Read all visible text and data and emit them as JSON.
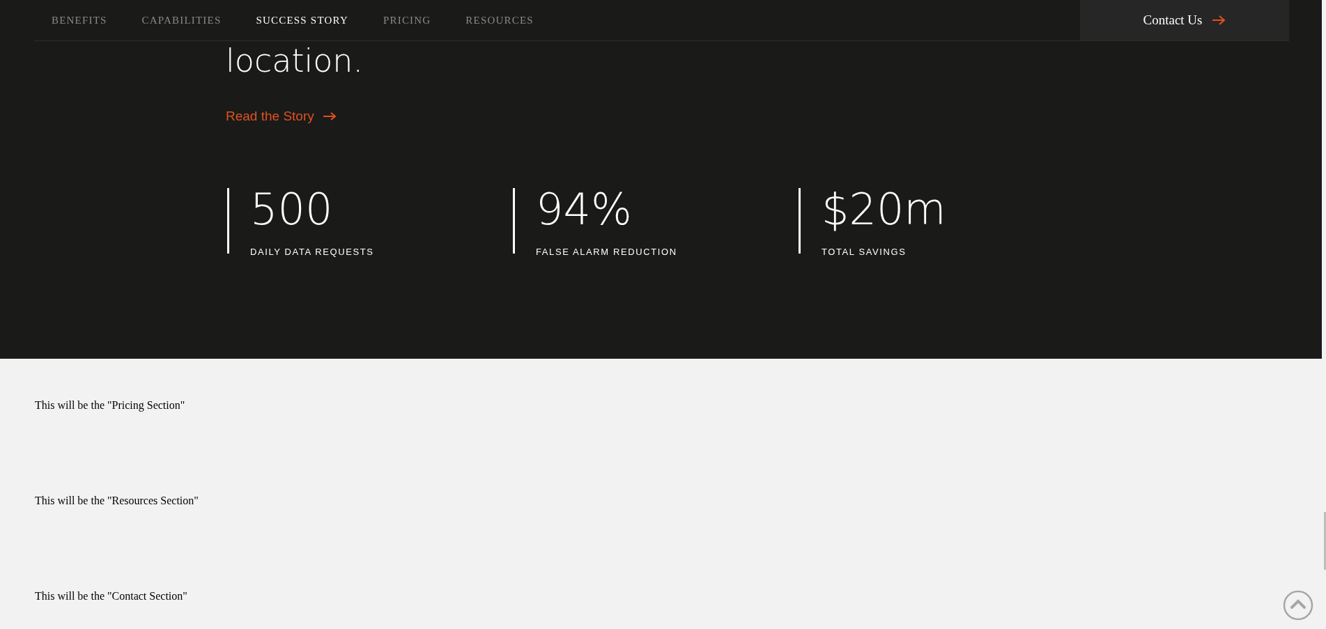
{
  "nav": {
    "items": [
      {
        "label": "BENEFITS",
        "selected": false
      },
      {
        "label": "CAPABILITIES",
        "selected": false
      },
      {
        "label": "SUCCESS STORY",
        "selected": true
      },
      {
        "label": "PRICING",
        "selected": false
      },
      {
        "label": "RESOURCES",
        "selected": false
      }
    ],
    "contact_button": "Contact Us"
  },
  "story": {
    "heading": "location.",
    "link": "Read the Story",
    "stats": [
      {
        "value": "500",
        "label": "DAILY DATA REQUESTS"
      },
      {
        "value": "94%",
        "label": "FALSE ALARM REDUCTION"
      },
      {
        "value": "$20m",
        "label": "TOTAL SAVINGS"
      }
    ]
  },
  "sections": [
    "This will be the \"Pricing Section\"",
    "This will be the \"Resources Section\"",
    "This will be the \"Contact Section\""
  ]
}
